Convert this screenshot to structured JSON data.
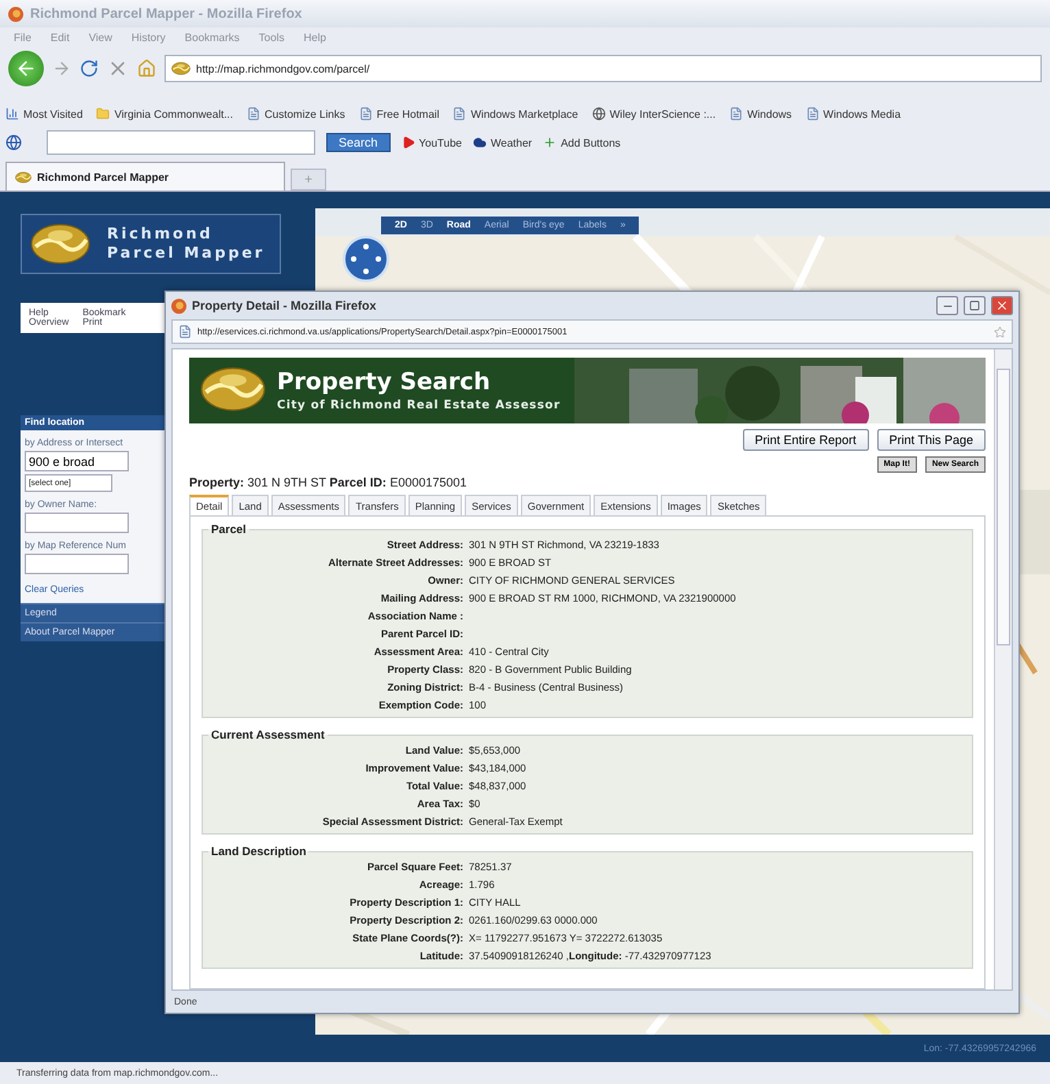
{
  "browser": {
    "title": "Richmond Parcel Mapper - Mozilla Firefox",
    "menu": [
      "File",
      "Edit",
      "View",
      "History",
      "Bookmarks",
      "Tools",
      "Help"
    ],
    "url": "http://map.richmondgov.com/parcel/",
    "bookmarks": [
      {
        "label": "Most Visited",
        "kind": "chart"
      },
      {
        "label": "Virginia Commonwealt...",
        "kind": "folder"
      },
      {
        "label": "Customize Links",
        "kind": "page"
      },
      {
        "label": "Free Hotmail",
        "kind": "page"
      },
      {
        "label": "Windows Marketplace",
        "kind": "page"
      },
      {
        "label": "Wiley InterScience :...",
        "kind": "globe"
      },
      {
        "label": "Windows",
        "kind": "page"
      },
      {
        "label": "Windows Media",
        "kind": "page"
      }
    ],
    "search_button": "Search",
    "toolbar_links": [
      {
        "label": "YouTube",
        "kind": "video"
      },
      {
        "label": "Weather",
        "kind": "weather"
      },
      {
        "label": "Add Buttons",
        "kind": "add"
      }
    ],
    "tabs": [
      {
        "label": "Richmond Parcel Mapper",
        "selected": true
      }
    ],
    "new_tab": "+",
    "status": "Transferring data from map.richmondgov.com..."
  },
  "sidebar": {
    "logo_lines": [
      "Richmond",
      "Parcel Mapper"
    ],
    "menu": [
      "Help",
      "Bookmark",
      "Overview",
      "Print"
    ],
    "find_panel": {
      "title": "Find location",
      "fields": [
        {
          "label": "by Address or Intersect",
          "value": "900 e broad",
          "select": "[select one]"
        },
        {
          "label": "by Owner Name:"
        },
        {
          "label": "by Map Reference Num"
        }
      ],
      "clear": "Clear Queries"
    },
    "sections": [
      "Legend",
      "About Parcel Mapper"
    ]
  },
  "map": {
    "groups": [
      [
        {
          "label": "2D",
          "selected": true
        },
        {
          "label": "3D",
          "selected": false
        }
      ],
      [
        {
          "label": "Road",
          "selected": true
        },
        {
          "label": "Aerial",
          "selected": false
        },
        {
          "label": "Bird's eye",
          "selected": false
        }
      ],
      [
        {
          "label": "Labels",
          "selected": false
        }
      ],
      [
        {
          "label": "»",
          "selected": false
        }
      ]
    ],
    "coords": "Lon: -77.43269957242966"
  },
  "popup": {
    "title": "Property Detail - Mozilla Firefox",
    "url": "http://eservices.ci.richmond.va.us/applications/PropertySearch/Detail.aspx?pin=E0000175001",
    "banner": {
      "title": "Property Search",
      "subtitle": "City of Richmond Real Estate Assessor"
    },
    "buttons": [
      "Print Entire Report",
      "Print This Page"
    ],
    "small_buttons": [
      "Map It!",
      "New Search"
    ],
    "property": {
      "label": "Property:",
      "value": "301 N 9TH ST",
      "parcel_label": "Parcel ID:",
      "parcel_value": "E0000175001"
    },
    "tabs": [
      {
        "label": "Detail",
        "selected": true
      },
      {
        "label": "Land",
        "selected": false
      },
      {
        "label": "Assessments",
        "selected": false
      },
      {
        "label": "Transfers",
        "selected": false
      },
      {
        "label": "Planning",
        "selected": false
      },
      {
        "label": "Services",
        "selected": false
      },
      {
        "label": "Government",
        "selected": false
      },
      {
        "label": "Extensions",
        "selected": false
      },
      {
        "label": "Images",
        "selected": false
      },
      {
        "label": "Sketches",
        "selected": false
      }
    ],
    "sections": [
      {
        "title": "Parcel",
        "rows": [
          {
            "label": "Street Address:",
            "value": "301 N 9TH ST Richmond, VA 23219-1833"
          },
          {
            "label": "Alternate Street Addresses:",
            "value": "900 E BROAD ST"
          },
          {
            "label": "Owner:",
            "value": "CITY OF RICHMOND GENERAL SERVICES"
          },
          {
            "label": "Mailing Address:",
            "value": "900 E BROAD ST RM 1000, RICHMOND, VA 2321900000"
          },
          {
            "label": "Association Name :"
          },
          {
            "label": "Parent Parcel ID:"
          },
          {
            "label": "Assessment Area:",
            "value": "410 - Central City"
          },
          {
            "label": "Property Class:",
            "value": "820 - B Government Public Building"
          },
          {
            "label": "Zoning District:",
            "value": "B-4 - Business (Central Business)"
          },
          {
            "label": "Exemption Code:",
            "value": "100"
          }
        ]
      },
      {
        "title": "Current Assessment",
        "rows": [
          {
            "label": "Land Value:",
            "value": "$5,653,000"
          },
          {
            "label": "Improvement Value:",
            "value": "$43,184,000"
          },
          {
            "label": "Total Value:",
            "value": "$48,837,000"
          },
          {
            "label": "Area Tax:",
            "value": "$0"
          },
          {
            "label": "Special Assessment District:",
            "value": "General-Tax Exempt"
          }
        ]
      },
      {
        "title": "Land Description",
        "rows": [
          {
            "label": "Parcel Square Feet:",
            "value": "78251.37"
          },
          {
            "label": "Acreage:",
            "value": "1.796"
          },
          {
            "label": "Property Description 1:",
            "value": "CITY HALL"
          },
          {
            "label": "Property Description 2:",
            "value": "0261.160/0299.63 0000.000"
          },
          {
            "label": "State Plane Coords(?):",
            "value": "X= 11792277.951673 Y= 3722272.613035"
          },
          {
            "label": "Latitude:",
            "value": "37.54090918126240 ,**Longitude:** -77.432970977123"
          }
        ]
      }
    ],
    "status": "Done"
  }
}
